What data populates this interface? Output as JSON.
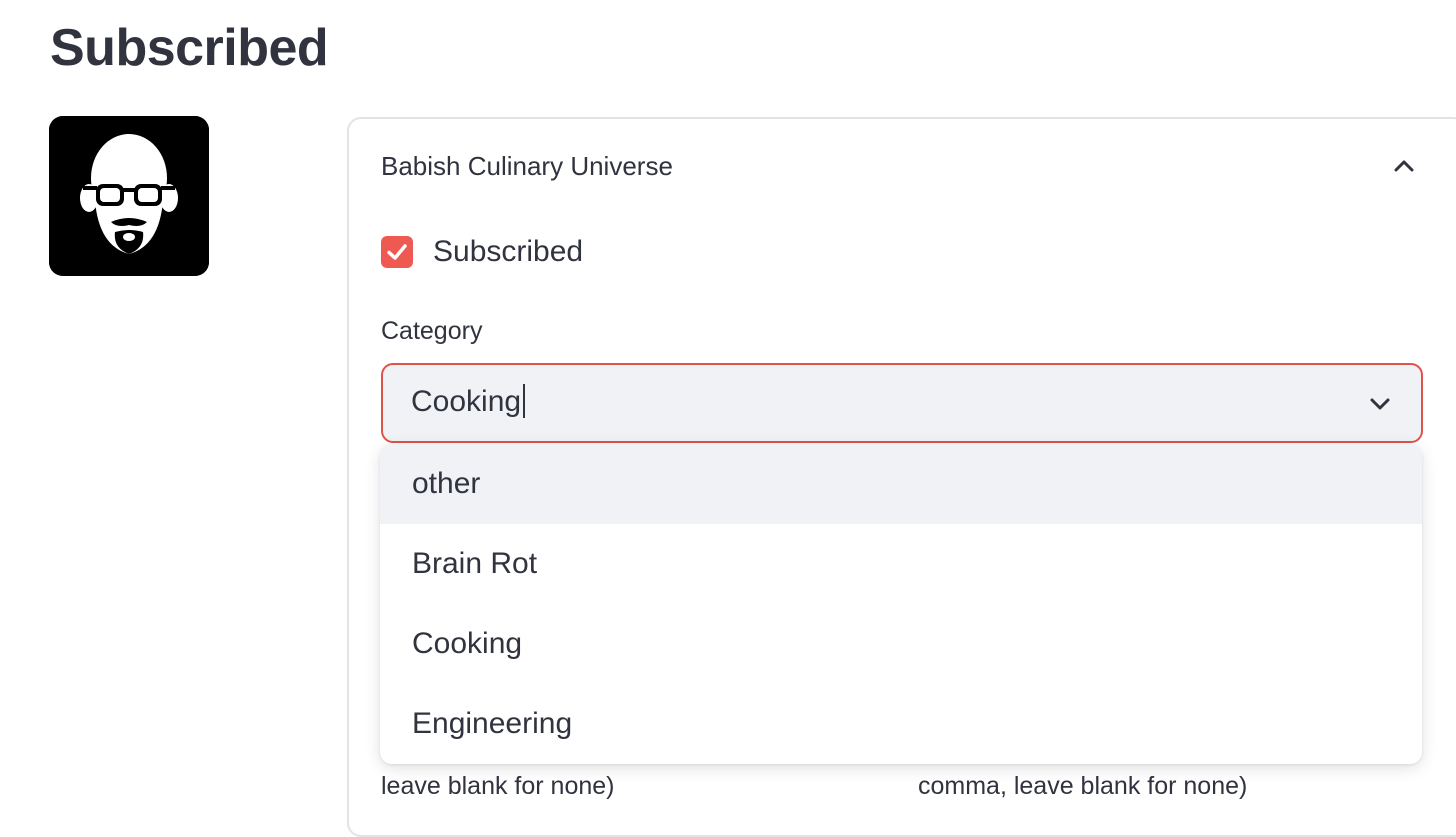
{
  "page": {
    "title": "Subscribed"
  },
  "channel": {
    "name": "Babish Culinary Universe",
    "subscribed_label": "Subscribed",
    "subscribed": true
  },
  "category": {
    "label": "Category",
    "input_value": "Cooking",
    "options": [
      "other",
      "Brain Rot",
      "Cooking",
      "Engineering"
    ],
    "highlighted_option": "other"
  },
  "help_text": {
    "left": "leave blank for none)",
    "right": "comma, leave blank for none)"
  },
  "colors": {
    "accent": "#ee5a52",
    "select_border": "#e0534b",
    "input_bg": "#f0f2f6",
    "text": "#31333f"
  },
  "icons": {
    "avatar": "bald-bearded-man-glasses-avatar",
    "expander_toggle": "chevron-up-icon",
    "select_toggle": "chevron-down-icon",
    "checkbox": "check-icon"
  }
}
